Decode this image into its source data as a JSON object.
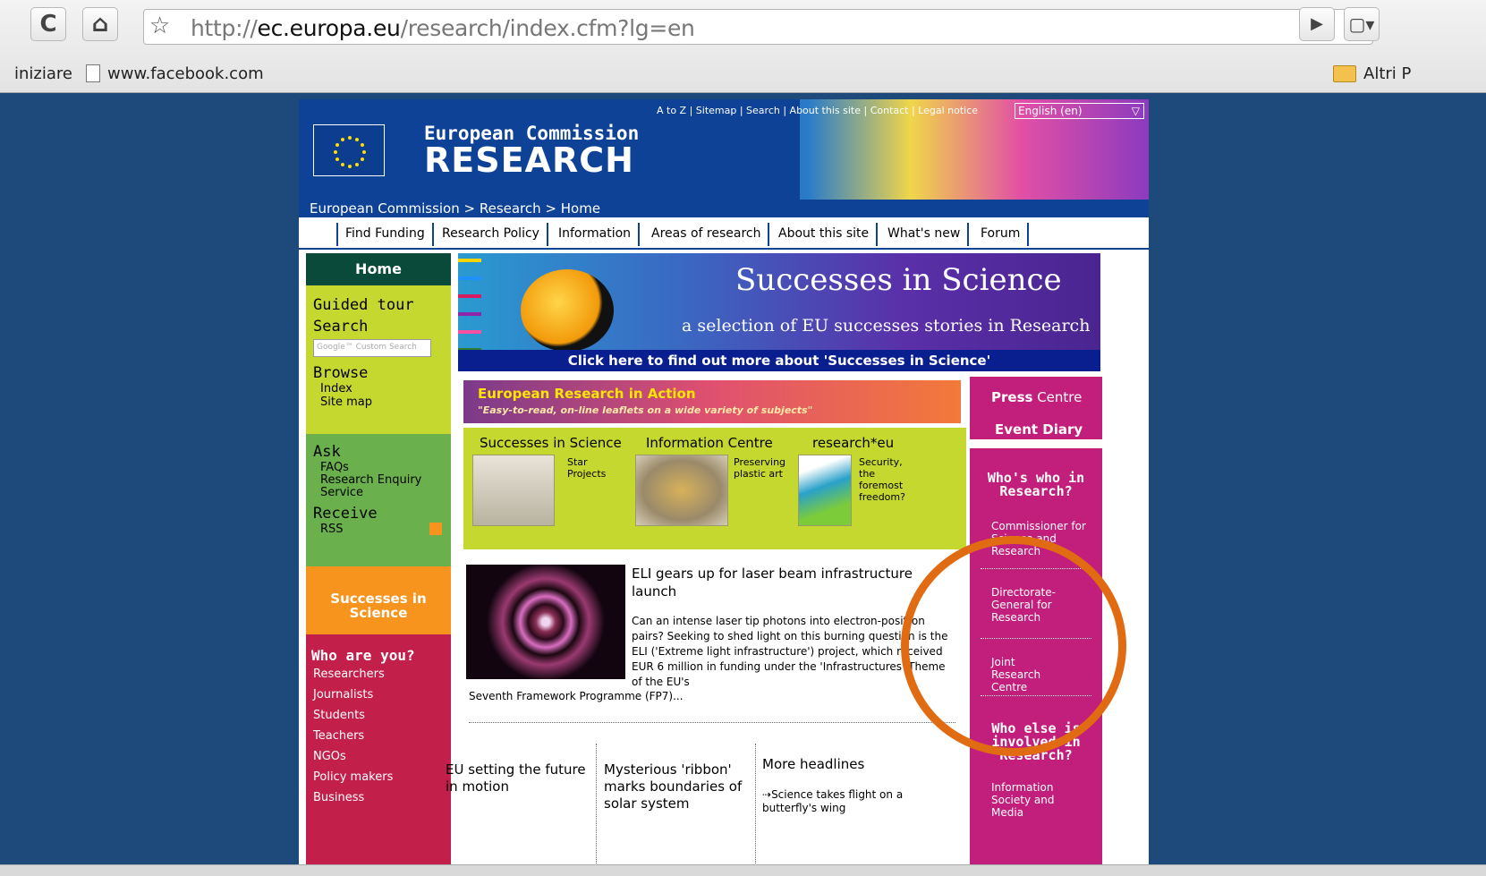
{
  "browser": {
    "reload_icon": "C",
    "home_icon": "home",
    "star_icon": "star",
    "url_prefix": "http://",
    "url_host": "ec.europa.eu",
    "url_path": "/research/index.cfm?lg=en",
    "bookmarks": [
      "iniziare",
      "www.facebook.com"
    ],
    "bookmarks_right": "Altri P"
  },
  "header": {
    "toplinks": "A to Z | Sitemap | Search | About this site | Contact | Legal notice",
    "language": "English (en)",
    "org": "European Commission",
    "title": "RESEARCH",
    "breadcrumb": "European Commission  > Research  > Home"
  },
  "topnav": [
    "Find Funding",
    "Research Policy",
    "Information",
    "Areas of research",
    "About this site",
    "What's new",
    "Forum"
  ],
  "left": {
    "home": "Home",
    "guided_tour": "Guided tour",
    "search": "Search",
    "search_placeholder": "Google™ Custom Search",
    "browse": "Browse",
    "index": "Index",
    "site_map": "Site map",
    "ask": "Ask",
    "faqs": "FAQs",
    "enquiry": "Research Enquiry Service",
    "receive": "Receive",
    "rss": "RSS",
    "successes": "Successes in Science",
    "who_are_you": "Who are you?",
    "audiences": [
      "Researchers",
      "Journalists",
      "Students",
      "Teachers",
      "NGOs",
      "Policy makers",
      "Business"
    ]
  },
  "banner": {
    "title": "Successes in Science",
    "subtitle": "a selection of EU successes stories in Research",
    "link": "Click here to find out more about 'Successes in Science'"
  },
  "action": {
    "title": "European Research in Action",
    "subtitle": "\"Easy-to-read, on-line leaflets on a wide variety of subjects\""
  },
  "tiles": [
    {
      "heading": "Successes in Science",
      "text": "Star Projects"
    },
    {
      "heading": "Information Centre",
      "text": "Preserving plastic art"
    },
    {
      "heading": "research*eu",
      "text": "Security, the foremost freedom?"
    }
  ],
  "news": {
    "headline": "ELI gears up for laser beam infrastructure launch",
    "body": "Can an intense laser tip photons into electron-positron pairs? Seeking to shed light on this burning question is the ELI ('Extreme light infrastructure') project, which received EUR 6 million in funding under the 'Infrastructures' Theme of the EU's",
    "body_end": "Seventh Framework Programme (FP7)..."
  },
  "headlines": {
    "h1": "EU setting the future in motion",
    "h2": "Mysterious 'ribbon' marks boundaries of solar system",
    "h3": "More headlines",
    "h3_item": "Science takes flight on a butterfly's wing"
  },
  "right": {
    "press_centre_bold": "Press",
    "press_centre_rest": " Centre",
    "event_diary": "Event Diary",
    "whos_who": "Who's who in Research?",
    "links": [
      "Commissioner for Science and Research",
      "Directorate-General for Research",
      "Joint Research Centre"
    ],
    "who_else": "Who else is involved in Research?",
    "info_society": "Information Society and Media"
  },
  "colors": {
    "annotation_ring": "#e06b12",
    "left_green": "#c5d82f",
    "magenta": "#c21f7c",
    "orange": "#f7941d",
    "navy": "#0d4297"
  }
}
